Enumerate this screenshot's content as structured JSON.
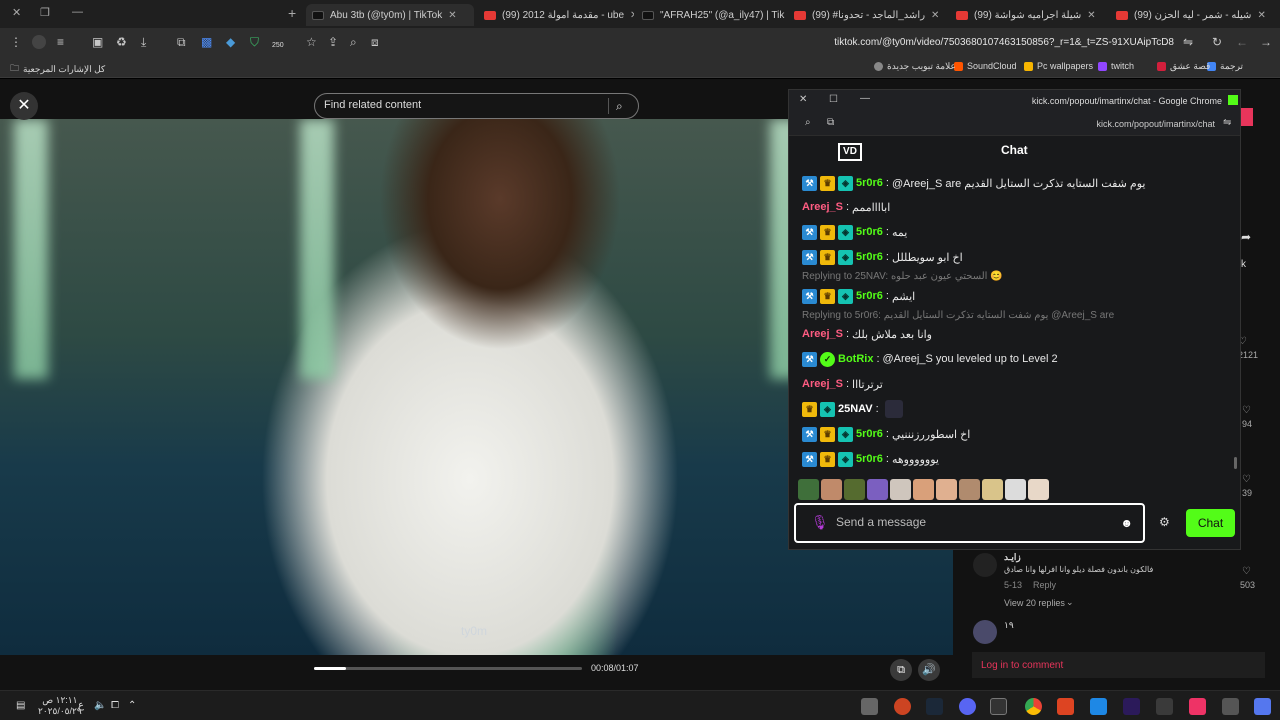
{
  "browser": {
    "tabs": [
      {
        "label": "(99) شيله - شمر - ليه الحزن",
        "active": false
      },
      {
        "label": "(99) شيلة اجراميه شواشة",
        "active": false
      },
      {
        "label": "(99) #راشد_الماجد - تحدونا",
        "active": false
      },
      {
        "label": "\"AFRAH25\" (@a_ily47) | Tik",
        "active": false
      },
      {
        "label": "(99) مقدمة امولة 2012 - ube",
        "active": false
      },
      {
        "label": "Abu 3tb (@ty0m) | TikTok",
        "active": true
      }
    ],
    "new_tab_symbol": "+",
    "url": "tiktok.com/@ty0m/video/7503680107463150856?_r=1&_t=ZS-91XUAipTcD8",
    "extension_badge": "250",
    "bookmarks": [
      {
        "label": "ترجمة",
        "color": "#4285f4"
      },
      {
        "label": "قصة عشق",
        "color": "#d21f3c"
      },
      {
        "label": "twitch",
        "color": "#9146ff"
      },
      {
        "label": "Pc wallpapers",
        "color": "#f7b500"
      },
      {
        "label": "SoundCloud",
        "color": "#ff5500"
      },
      {
        "label": "علامة تبويب جديدة",
        "color": "#888888"
      }
    ],
    "all_bookmarks": "كل الإشارات المرجعية"
  },
  "tiktok": {
    "search_placeholder": "Find related content",
    "watermark": "ty0m",
    "progress": 0.12,
    "time": "00:08/01:07",
    "likes": "2121",
    "comments": "94",
    "saves": "39",
    "shares": "503",
    "comment": {
      "author": "زايـد",
      "text": "فالكون باندون فصلة ديلو وانا افرلها وانا صادق",
      "date": "5-13",
      "reply": "Reply",
      "view_replies": "View 20 replies"
    },
    "comment2_author": "١٩",
    "login": "Log in to comment",
    "side_k": "k"
  },
  "popup": {
    "window_title": "kick.com/popout/imartinx/chat - Google Chrome",
    "url": "kick.com/popout/imartinx/chat",
    "chat_title": "Chat",
    "logo": "VD",
    "messages": [
      {
        "user": "5r0r6",
        "badges": [
          "tool",
          "crown",
          "sub"
        ],
        "text": "@Areej_S are يوم شفت الستايه تذكرت الستايل القديم"
      },
      {
        "user": "Areej_S",
        "badges": [],
        "text": "ابااااممم"
      },
      {
        "user": "5r0r6",
        "badges": [
          "tool",
          "crown",
          "sub"
        ],
        "text": "يمه"
      },
      {
        "user": "5r0r6",
        "badges": [
          "tool",
          "crown",
          "sub"
        ],
        "text": "اخ ابو سويطللل"
      },
      {
        "reply": "Replying to 25NAV: السحتي عيون عبد حلوه 😊"
      },
      {
        "user": "5r0r6",
        "badges": [
          "tool",
          "crown",
          "sub"
        ],
        "text": "ايشم"
      },
      {
        "reply": "Replying to 5r0r6: يوم شفت الستايه تذكرت الستايل القديم @Areej_S are"
      },
      {
        "user": "Areej_S",
        "badges": [],
        "text": "وانا بعد ملاش بلك"
      },
      {
        "user": "BotRix",
        "badges": [
          "tool",
          "ver"
        ],
        "text": "@Areej_S you leveled up to Level 2"
      },
      {
        "user": "Areej_S",
        "badges": [],
        "text": "ترترتااا"
      },
      {
        "user": "25NAV",
        "badges": [
          "crown",
          "sub"
        ],
        "text": ""
      },
      {
        "user": "5r0r6",
        "badges": [
          "tool",
          "crown",
          "sub"
        ],
        "text": "اخ اسطوررزنننيي"
      },
      {
        "user": "5r0r6",
        "badges": [
          "tool",
          "crown",
          "sub"
        ],
        "text": "يووووووهه"
      }
    ],
    "emote_colors": [
      "#3f6f3a",
      "#c08a6a",
      "#556b2f",
      "#7b5fc0",
      "#cfc6bd",
      "#d9a07a",
      "#e0b090",
      "#b08b6e",
      "#d9c48a",
      "#dcdcdc",
      "#e8d8c8"
    ],
    "input_placeholder": "Send a message",
    "send_label": "Chat",
    "colors": {
      "kick_green": "#53fc18",
      "areej_pink": "#ff5c82"
    }
  },
  "taskbar": {
    "time": "١٢:١١ ص",
    "date": "٢٠٢٥/٠٥/٢٩",
    "lang": "ع"
  }
}
